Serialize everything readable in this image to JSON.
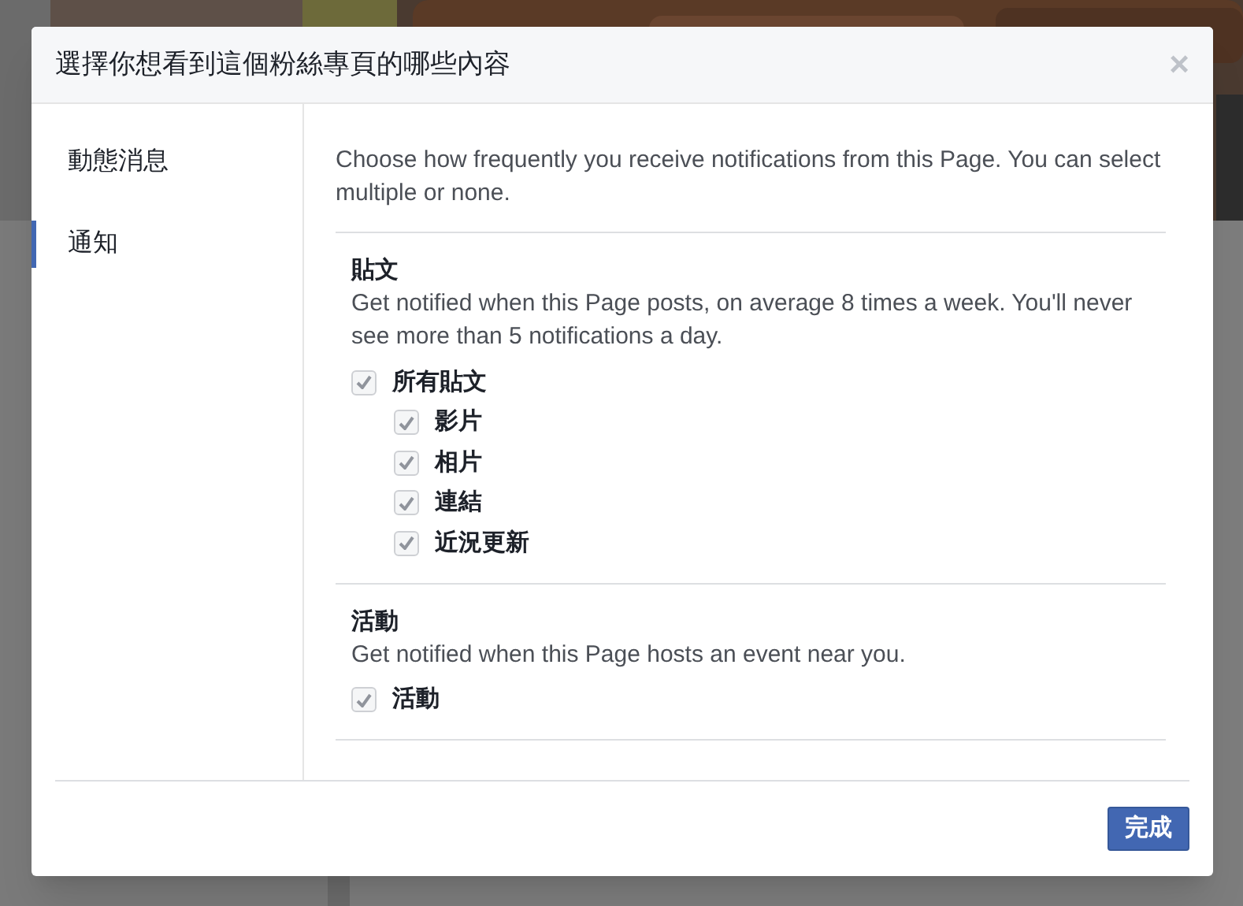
{
  "dialog": {
    "title": "選擇你想看到這個粉絲專頁的哪些內容",
    "close": "×"
  },
  "nav": [
    {
      "label": "動態消息",
      "selected": false
    },
    {
      "label": "通知",
      "selected": true
    }
  ],
  "intro": "Choose how frequently you receive notifications from this Page. You can select multiple or none.",
  "sections": [
    {
      "title": "貼文",
      "description": "Get notified when this Page posts, on average 8 times a week. You'll never see more than 5 notifications a day.",
      "options": [
        {
          "label": "所有貼文",
          "checked": true,
          "children": [
            {
              "label": "影片",
              "checked": true
            },
            {
              "label": "相片",
              "checked": true
            },
            {
              "label": "連結",
              "checked": true
            },
            {
              "label": "近況更新",
              "checked": true
            }
          ]
        }
      ]
    },
    {
      "title": "活動",
      "description": "Get notified when this Page hosts an event near you.",
      "options": [
        {
          "label": "活動",
          "checked": true
        }
      ]
    }
  ],
  "done_button": "完成"
}
